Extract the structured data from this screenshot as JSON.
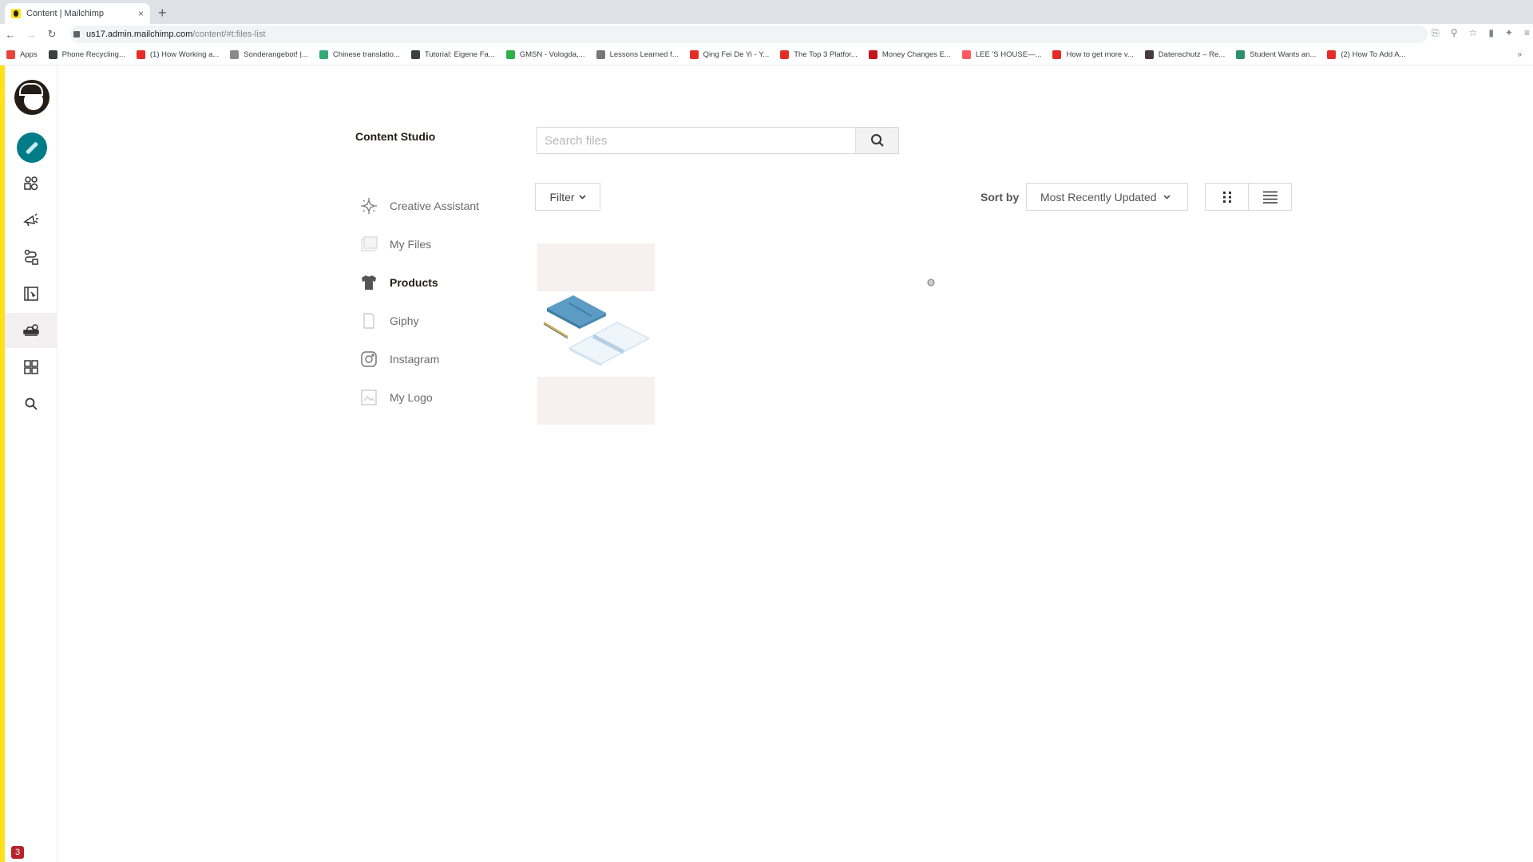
{
  "browser": {
    "tab_title": "Content | Mailchimp",
    "tab_close": "×",
    "new_tab": "+",
    "url_host": "us17.admin.mailchimp.com",
    "url_path": "/content/#t:files-list",
    "bookmarks": [
      {
        "label": "Apps",
        "icon": "apps-grid-icon",
        "color": "#e8453c"
      },
      {
        "label": "Phone Recycling...",
        "icon": "o2-icon",
        "color": "#3c4043"
      },
      {
        "label": "(1) How Working a...",
        "icon": "youtube-icon",
        "color": "#e52d27"
      },
      {
        "label": "Sonderangebot! |...",
        "icon": "globe-icon",
        "color": "#8a8a8a"
      },
      {
        "label": "Chinese translatio...",
        "icon": "site-icon",
        "color": "#34a87a"
      },
      {
        "label": "Tutorial: Eigene Fa...",
        "icon": "hash-icon",
        "color": "#3c4043"
      },
      {
        "label": "GMSN - Vologda,...",
        "icon": "site-icon",
        "color": "#2fb14a"
      },
      {
        "label": "Lessons Learned f...",
        "icon": "site-icon",
        "color": "#777777"
      },
      {
        "label": "Qing Fei De Yi - Y...",
        "icon": "youtube-icon",
        "color": "#e52d27"
      },
      {
        "label": "The Top 3 Platfor...",
        "icon": "youtube-icon",
        "color": "#e52d27"
      },
      {
        "label": "Money Changes E...",
        "icon": "youtube-icon",
        "color": "#c4161c"
      },
      {
        "label": "LEE 'S HOUSE—...",
        "icon": "airbnb-icon",
        "color": "#ff5a5f"
      },
      {
        "label": "How to get more v...",
        "icon": "youtube-icon",
        "color": "#e52d27"
      },
      {
        "label": "Datenschutz – Re...",
        "icon": "site-icon",
        "color": "#4a3b3b"
      },
      {
        "label": "Student Wants an...",
        "icon": "site-icon",
        "color": "#2f8f6f"
      },
      {
        "label": "(2) How To Add A...",
        "icon": "youtube-icon",
        "color": "#e52d27"
      }
    ],
    "bookmarks_more": "»"
  },
  "sidebar": {
    "items": [
      {
        "name": "create",
        "icon": "pencil-icon"
      },
      {
        "name": "audience",
        "icon": "audience-icon"
      },
      {
        "name": "campaigns",
        "icon": "megaphone-icon"
      },
      {
        "name": "automations",
        "icon": "automation-icon"
      },
      {
        "name": "website",
        "icon": "website-icon"
      },
      {
        "name": "content-studio",
        "icon": "content-studio-icon",
        "active": true
      },
      {
        "name": "integrations",
        "icon": "grid-icon"
      },
      {
        "name": "search",
        "icon": "search-icon"
      }
    ],
    "notification_count": "3"
  },
  "main": {
    "title": "Content Studio",
    "search_placeholder": "Search files",
    "folders": [
      {
        "label": "Creative Assistant",
        "icon": "sparkle-icon",
        "active": false
      },
      {
        "label": "My Files",
        "icon": "images-icon",
        "active": false
      },
      {
        "label": "Products",
        "icon": "tshirt-icon",
        "active": true
      },
      {
        "label": "Giphy",
        "icon": "giphy-icon",
        "active": false
      },
      {
        "label": "Instagram",
        "icon": "instagram-icon",
        "active": false
      },
      {
        "label": "My Logo",
        "icon": "logo-image-icon",
        "active": false
      }
    ],
    "filter_label": "Filter",
    "sort_label": "Sort by",
    "sort_value": "Most Recently Updated",
    "view_modes": [
      "grid",
      "list"
    ],
    "colors": {
      "accent": "#007c89",
      "brand_yellow": "#ffe01b",
      "card_placeholder": "#f6f0f1"
    }
  }
}
